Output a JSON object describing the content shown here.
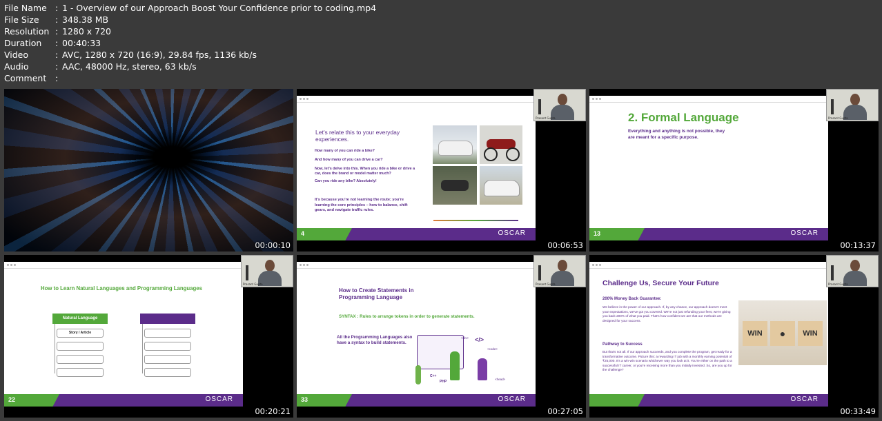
{
  "meta": [
    {
      "key": "File Name",
      "value": "1 - Overview of our Approach Boost Your Confidence prior to coding.mp4"
    },
    {
      "key": "File Size",
      "value": "348.38 MB"
    },
    {
      "key": "Resolution",
      "value": "1280 x 720"
    },
    {
      "key": "Duration",
      "value": "00:40:33"
    },
    {
      "key": "Video",
      "value": "AVC, 1280 x 720 (16:9), 29.84 fps, 1136 kb/s"
    },
    {
      "key": "Audio",
      "value": "AAC, 48000 Hz, stereo, 63 kb/s"
    },
    {
      "key": "Comment",
      "value": ""
    }
  ],
  "separator": ":",
  "thumbs": [
    {
      "time": "00:00:10"
    },
    {
      "time": "00:06:53",
      "slide_num": "4",
      "heading": "Let's relate this to your everyday experiences.",
      "bullets": [
        "How many of you can ride a bike?",
        "And how many of you can drive a car?",
        "Now, let's delve into this. When you ride a bike or drive a car, does the brand or model matter much?",
        "Can you ride any bike? Absolutely!"
      ],
      "closing": "It's because you're not learning the route; you're learning the core principles – how to balance, shift gears, and navigate traffic rules."
    },
    {
      "time": "00:13:37",
      "slide_num": "13",
      "heading": "2. Formal Language",
      "sub": "Everything and anything is not possible, they are meant for a specific purpose."
    },
    {
      "time": "00:20:21",
      "slide_num": "22",
      "heading": "How to Learn Natural Languages and Programming Languages",
      "box_label": "Natural Language",
      "item": "Story / Article"
    },
    {
      "time": "00:27:05",
      "slide_num": "33",
      "heading": "How to Create Statements in Programming Language",
      "syntax": "SYNTAX : Rules to arrange tokens in order to generate statements.",
      "body": "All the Programming Languages also have a syntax to build statements.",
      "tags": [
        "<div>",
        "</>",
        "<code>",
        "C++",
        "PHP",
        "<head>"
      ]
    },
    {
      "time": "00:33:49",
      "heading": "Challenge Us, Secure Your Future",
      "h1": "200% Money Back Guarantee:",
      "p1": "We believe in the power of our approach. If, by any chance, our approach doesn't meet your expectations, we've got you covered. We're not just refunding your fees; we're giving you back 200% of what you paid. That's how confident we are that our methods are designed for your success.",
      "h2": "Pathway to Success",
      "p2": "But that's not all. If our approach succeeds, and you complete the program, get ready for a transformative outcome. Picture this: a rewarding IT job with a monthly earning potential of ₹25,000. It's a win-win scenario whichever way you look at it. You're either on the path to a successful IT career, or you're receiving more than you initially invested. So, are you up for the challenge?",
      "win1": "WIN",
      "win2": "WIN"
    }
  ],
  "logo": "OSCAR",
  "presenter_tag": "Prasant Gupta"
}
